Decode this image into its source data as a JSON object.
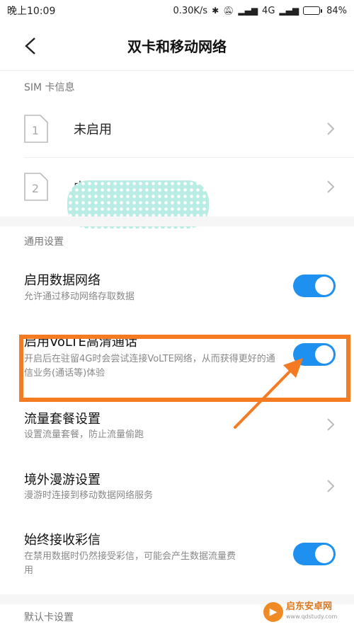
{
  "statusbar": {
    "time": "晚上10:09",
    "speed": "0.30K/s",
    "network": "4G",
    "battery_percent": "84%",
    "battery_level": 0.84
  },
  "navbar": {
    "title": "双卡和移动网络",
    "back_icon": "chevron-left-icon"
  },
  "sim_section": {
    "header": "SIM 卡信息",
    "items": [
      {
        "slot": "1",
        "label": "未启用"
      },
      {
        "slot": "2",
        "label": "中国移动"
      }
    ]
  },
  "general_section": {
    "header": "通用设置",
    "items": [
      {
        "title": "启用数据网络",
        "subtitle": "允许通过移动网络存取数据",
        "control": "toggle",
        "on": true
      },
      {
        "title": "启用VoLTE高清通话",
        "subtitle": "开启后在驻留4G时会尝试连接VoLTE网络，从而获得更好的通信业务(通话等)体验",
        "control": "toggle",
        "on": true
      },
      {
        "title": "流量套餐设置",
        "subtitle": "设置流量套餐，防止流量偷跑",
        "control": "chevron"
      },
      {
        "title": "境外漫游设置",
        "subtitle": "漫游时连接到移动数据网络服务",
        "control": "chevron"
      },
      {
        "title": "始终接收彩信",
        "subtitle": "在禁用数据时仍然接受彩信，可能会产生数据流量费用",
        "control": "toggle",
        "on": true
      }
    ]
  },
  "default_card_section": {
    "header": "默认卡设置"
  },
  "watermark": {
    "name": "启东安卓网",
    "url": "www.qdstudy.com"
  },
  "colors": {
    "toggle_on": "#1e90f0",
    "highlight": "#f47b22"
  }
}
